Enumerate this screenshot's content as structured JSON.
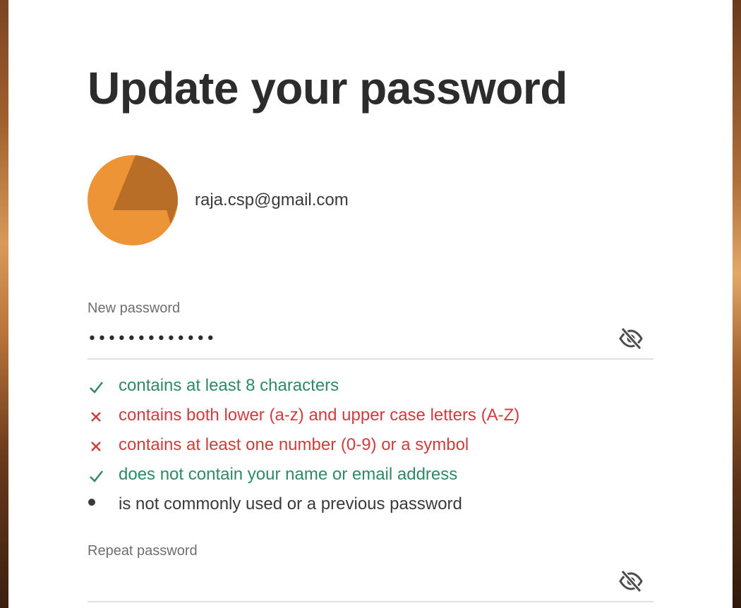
{
  "page": {
    "title": "Update your password"
  },
  "account": {
    "email": "raja.csp@gmail.com",
    "avatar_colors": {
      "base": "#ec9436",
      "accent": "#b86e27"
    }
  },
  "new_password": {
    "label": "New password",
    "masked_value": "•••••••••••••",
    "toggle_icon": "eye-slash-icon"
  },
  "requirements": [
    {
      "status": "met",
      "icon": "check-icon",
      "text": "contains at least 8 characters"
    },
    {
      "status": "unmet",
      "icon": "cross-icon",
      "text": "contains both lower (a-z) and upper case letters (A-Z)"
    },
    {
      "status": "unmet",
      "icon": "cross-icon",
      "text": "contains at least one number (0-9) or a symbol"
    },
    {
      "status": "met",
      "icon": "check-icon",
      "text": "does not contain your name or email address"
    },
    {
      "status": "pending",
      "icon": "bullet-icon",
      "text": "is not commonly used or a previous password"
    }
  ],
  "repeat_password": {
    "label": "Repeat password",
    "value": "",
    "toggle_icon": "eye-slash-icon"
  },
  "colors": {
    "met": "#2d8a65",
    "unmet": "#d03c3c",
    "pending": "#3a3a3a",
    "title": "#2c2c2c"
  }
}
